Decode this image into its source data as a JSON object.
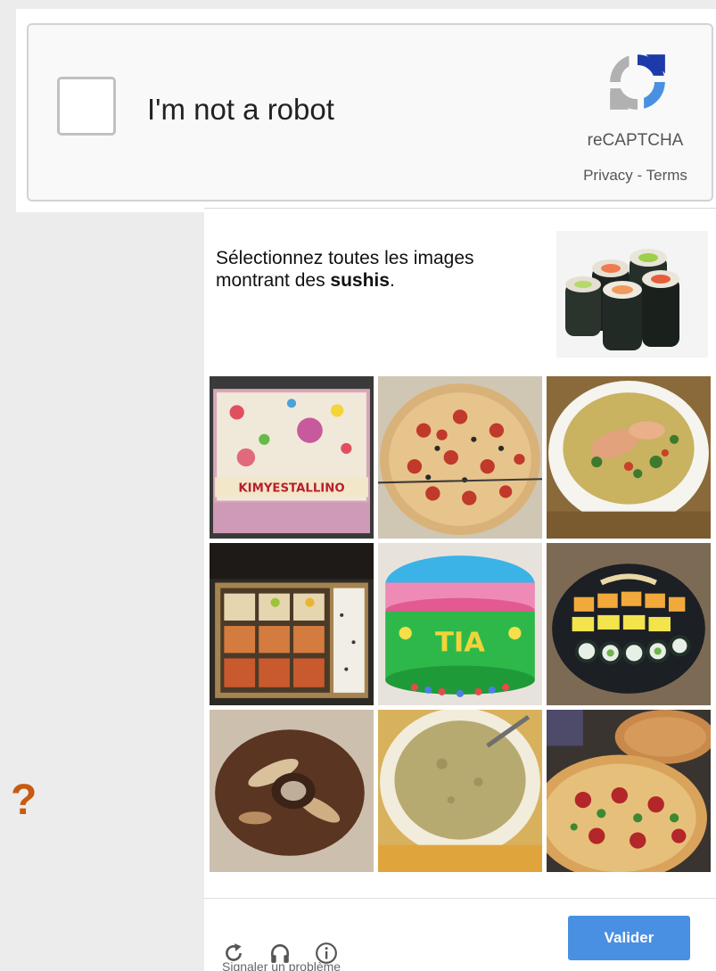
{
  "widget": {
    "checkbox_label": "I'm not a robot",
    "brand": "reCAPTCHA",
    "privacy": "Privacy",
    "separator": " - ",
    "terms": "Terms",
    "logo_icon": "recaptcha-logo-icon",
    "colors": {
      "blue": "#1c3aa9",
      "light_blue": "#4a90e2",
      "gray": "#b1b1b1"
    }
  },
  "challenge": {
    "prompt_text": "Sélectionnez toutes les images montrant des ",
    "prompt_target": "sushis",
    "prompt_end": ".",
    "sample_image": "sushi-rolls-image",
    "tiles": [
      {
        "name": "tile-cake-kimyestallino",
        "subject": "decorated cake",
        "text": "KIMYESTALLINO"
      },
      {
        "name": "tile-pizza",
        "subject": "pizza"
      },
      {
        "name": "tile-soup-bowl",
        "subject": "soup"
      },
      {
        "name": "tile-sushi-box",
        "subject": "sushi box"
      },
      {
        "name": "tile-cake-tia",
        "subject": "decorated cake",
        "text": "TIA"
      },
      {
        "name": "tile-sushi-platter",
        "subject": "sushi platter"
      },
      {
        "name": "tile-donut",
        "subject": "donut"
      },
      {
        "name": "tile-creamy-soup",
        "subject": "soup"
      },
      {
        "name": "tile-pizzas",
        "subject": "pizzas"
      }
    ],
    "validate_label": "Valider",
    "hint": "Signaler un problème",
    "accent_color": "#4a90e2"
  },
  "side_mark": "?"
}
